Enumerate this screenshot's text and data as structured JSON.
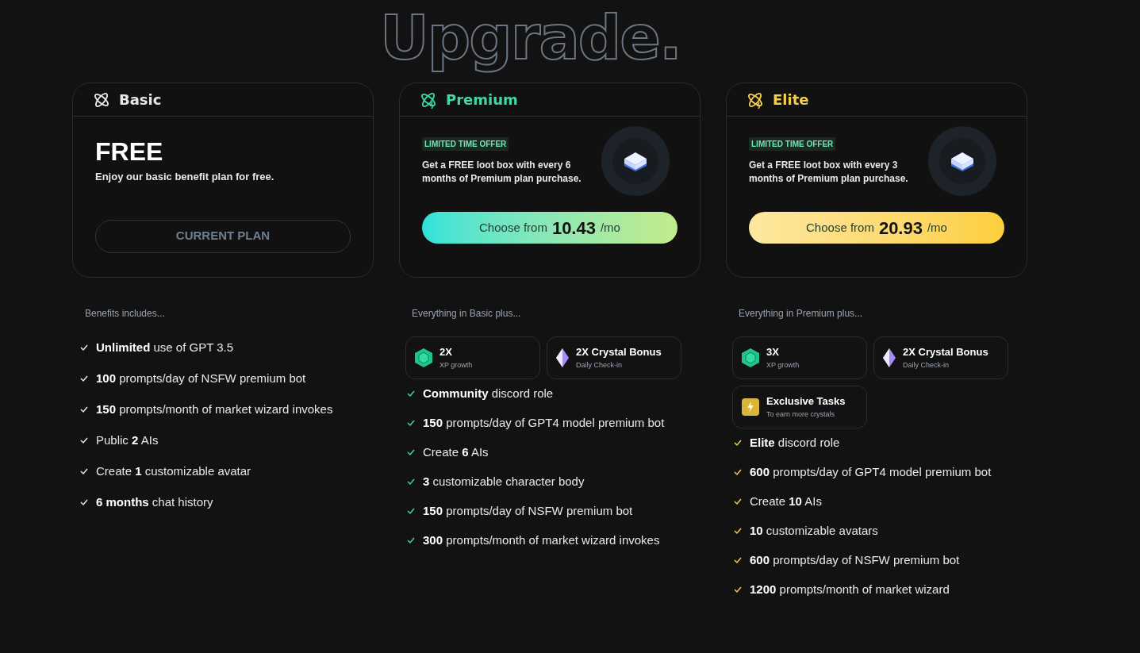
{
  "title": "Upgrade.",
  "plans": [
    {
      "kind": "basic",
      "name": "Basic",
      "color": "#e5e7eb",
      "price": "FREE",
      "description": "Enjoy our basic benefit plan for free.",
      "button": {
        "label": "CURRENT PLAN"
      },
      "benefits_heading": "Benefits includes...",
      "benefits": [
        "**Unlimited** use of GPT 3.5",
        "**100** prompts/day of NSFW premium bot",
        "**150** prompts/month of market wizard invokes",
        "Public **2** AIs",
        "Create **1** customizable avatar",
        "**6 months** chat history"
      ]
    },
    {
      "kind": "premium",
      "name": "Premium",
      "color": "#3fd9a6",
      "offer": {
        "badge": "LIMITED TIME OFFER",
        "text": "Get a FREE loot box with every 6 months of Premium plan purchase."
      },
      "button": {
        "prefix": "Choose from",
        "amount": "10.43",
        "suffix": "/mo"
      },
      "benefits_heading": "Everything in Basic plus...",
      "perks": [
        {
          "kind": "xp",
          "title": "2X",
          "subtitle": "XP growth"
        },
        {
          "kind": "crystal",
          "title": "2X Crystal Bonus",
          "subtitle": "Daily Check-in"
        }
      ],
      "benefits": [
        "**Community** discord role",
        "**150** prompts/day of GPT4 model premium bot",
        "Create **6** AIs",
        "**3** customizable character body",
        "**150** prompts/day of NSFW premium bot",
        "**300** prompts/month of market wizard invokes"
      ]
    },
    {
      "kind": "elite",
      "name": "Elite",
      "color": "#f4cf4f",
      "offer": {
        "badge": "LIMITED TIME OFFER",
        "text": "Get a FREE loot box with every 3 months of Premium plan purchase."
      },
      "button": {
        "prefix": "Choose from",
        "amount": "20.93",
        "suffix": "/mo"
      },
      "benefits_heading": "Everything in Premium plus...",
      "perks": [
        {
          "kind": "xp",
          "title": "3X",
          "subtitle": "XP growth"
        },
        {
          "kind": "crystal",
          "title": "2X Crystal Bonus",
          "subtitle": "Daily Check-in"
        },
        {
          "kind": "tasks",
          "title": "Exclusive Tasks",
          "subtitle": "To earn more crystals"
        }
      ],
      "benefits": [
        "**Elite** discord role",
        "**600** prompts/day of GPT4 model premium bot",
        "Create **10** AIs",
        "**10** customizable avatars",
        "**600** prompts/day of NSFW premium bot",
        "**1200** prompts/month of market wizard"
      ]
    }
  ]
}
